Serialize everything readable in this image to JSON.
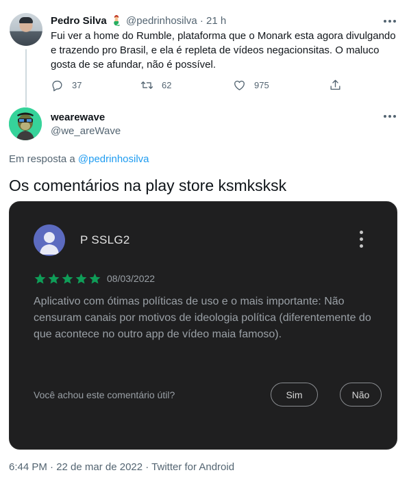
{
  "parent_tweet": {
    "name": "Pedro Silva",
    "handle": "@pedrinhosilva",
    "separator": "·",
    "time": "21 h",
    "text": "Fui ver a home do Rumble, plataforma que o Monark esta agora divulgando e trazendo pro Brasil, e ela é repleta de vídeos negacionsitas. O maluco gosta de se afundar, não é possível.",
    "replies": "37",
    "retweets": "62",
    "likes": "975"
  },
  "main_tweet": {
    "name": "wearewave",
    "handle": "@we_areWave",
    "reply_prefix": "Em resposta a",
    "reply_to": "@pedrinhosilva",
    "text": "Os comentários na play store ksmksksk",
    "footer": "6:44 PM · 22 de mar de 2022 · Twitter for Android"
  },
  "review_image": {
    "reviewer": "P SSLG2",
    "stars": 5,
    "date": "08/03/2022",
    "text": "Aplicativo com ótimas políticas de uso e o mais importante: Não censuram canais por motivos de ideologia política (diferentemente do que acontece no outro app de vídeo maia famoso).",
    "helpful_question": "Você achou este comentário útil?",
    "yes_label": "Sim",
    "no_label": "Não"
  },
  "colors": {
    "link": "#1d9bf0",
    "secondary_text": "#536471",
    "star": "#0f9d58",
    "review_bg": "#1f1f20"
  }
}
